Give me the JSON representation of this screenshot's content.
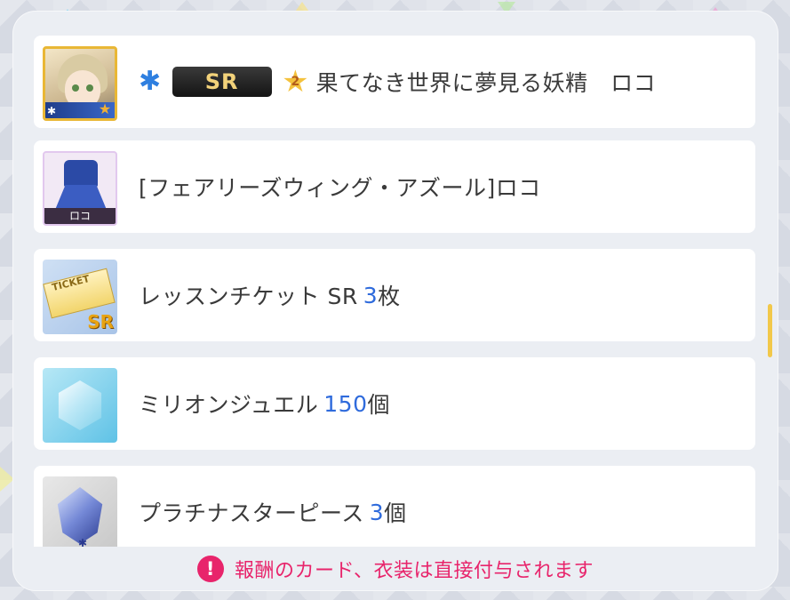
{
  "rewards": [
    {
      "kind": "card",
      "type_icon": "snowflake-icon",
      "rarity": "SR",
      "awake_level": "2",
      "title": "果てなき世界に夢見る妖精　ロコ"
    },
    {
      "kind": "costume",
      "thumb_label": "ロコ",
      "title": "[フェアリーズウィング・アズール]ロコ"
    },
    {
      "kind": "ticket",
      "thumb_label": "TICKET",
      "thumb_rarity": "SR",
      "name": "レッスンチケット SR",
      "quantity": "3",
      "unit": "枚"
    },
    {
      "kind": "jewel",
      "name": "ミリオンジュエル",
      "quantity": "150",
      "unit": "個"
    },
    {
      "kind": "piece",
      "name": "プラチナスターピース",
      "quantity": "3",
      "unit": "個"
    }
  ],
  "notice": {
    "icon": "!",
    "text": "報酬のカード、衣装は直接付与されます"
  },
  "colors": {
    "quantity": "#2f6bdc",
    "notice": "#e8246b",
    "rarity_text": "#f2d27a",
    "scroll_thumb": "#f2c84a"
  }
}
